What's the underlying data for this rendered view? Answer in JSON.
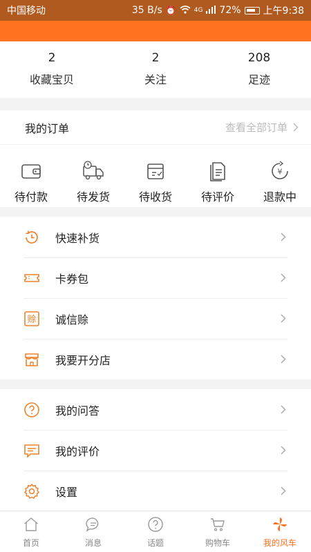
{
  "status_bar": {
    "carrier": "中国移动",
    "speed": "35 B/s",
    "signal": "4G",
    "battery": "72%",
    "time": "上午9:38"
  },
  "stats": [
    {
      "num": "2",
      "label": "收藏宝贝"
    },
    {
      "num": "2",
      "label": "关注"
    },
    {
      "num": "208",
      "label": "足迹"
    }
  ],
  "orders": {
    "title": "我的订单",
    "view_all": "查看全部订单",
    "items": [
      {
        "label": "待付款",
        "icon": "wallet-icon"
      },
      {
        "label": "待发货",
        "icon": "truck-icon"
      },
      {
        "label": "待收货",
        "icon": "box-icon"
      },
      {
        "label": "待评价",
        "icon": "review-icon"
      },
      {
        "label": "退款中",
        "icon": "refund-icon"
      }
    ]
  },
  "menu_a": [
    {
      "label": "快速补货",
      "icon": "restock-icon"
    },
    {
      "label": "卡券包",
      "icon": "coupon-icon"
    },
    {
      "label": "诚信赊",
      "icon": "credit-icon"
    },
    {
      "label": "我要开分店",
      "icon": "store-icon"
    }
  ],
  "menu_b": [
    {
      "label": "我的问答",
      "icon": "question-icon"
    },
    {
      "label": "我的评价",
      "icon": "comment-icon"
    },
    {
      "label": "设置",
      "icon": "settings-icon"
    }
  ],
  "credit_icon_char": "赊",
  "tabbar": [
    {
      "label": "首页",
      "icon": "home-icon"
    },
    {
      "label": "消息",
      "icon": "message-icon"
    },
    {
      "label": "话题",
      "icon": "topic-icon"
    },
    {
      "label": "购物车",
      "icon": "cart-icon"
    },
    {
      "label": "我的风车",
      "icon": "pinwheel-icon",
      "active": true
    }
  ],
  "colors": {
    "accent": "#ff7320",
    "status_bar": "#b05a1f",
    "icon_orange": "#f0822c",
    "icon_gray": "#666666"
  }
}
